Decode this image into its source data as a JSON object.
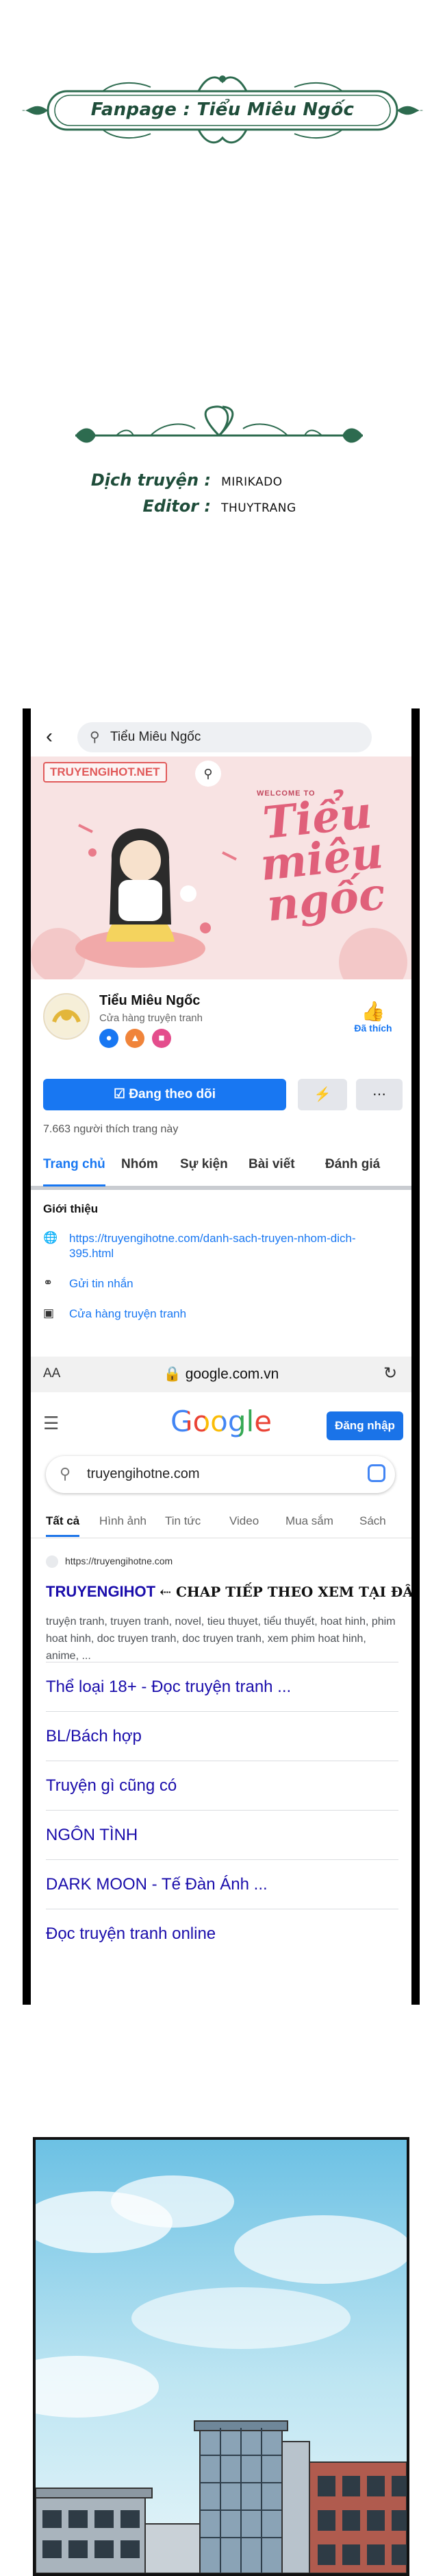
{
  "credits": {
    "fanpage_label": "Fanpage : Tiểu Miêu Ngốc",
    "translator_key": "Dịch truyện :",
    "translator_value": "MIRIKADO",
    "editor_key": "Editor :",
    "editor_value": "THUYTRANG"
  },
  "facebook": {
    "search_query": "Tiểu Miêu Ngốc",
    "cover": {
      "watermark": "TRUYENGIHOT.NET",
      "welcome": "WELCOME TO",
      "title": "Tiểu miêu ngốc"
    },
    "page_name": "Tiểu Miêu Ngốc",
    "page_category": "Cửa hàng truyện tranh",
    "like_label": "Đã thích",
    "follow_label": "Đang theo dõi",
    "likes_count": "7.663 người thích trang này",
    "tabs": [
      "Trang chủ",
      "Nhóm",
      "Sự kiện",
      "Bài viết",
      "Đánh giá"
    ],
    "intro_heading": "Giới thiệu",
    "intro_link": "https://truyengihotne.com/danh-sach-truyen-nhom-dich-395.html",
    "intro_message": "Gửi tin nhắn",
    "intro_category": "Cửa hàng truyện tranh"
  },
  "browser": {
    "text_size": "AA",
    "url": "google.com.vn"
  },
  "google": {
    "logo": "Google",
    "sign_in": "Đăng nhập",
    "query": "truyengihotne.com",
    "tabs": [
      "Tất cả",
      "Hình ảnh",
      "Tin tức",
      "Video",
      "Mua sắm",
      "Sách"
    ],
    "result": {
      "url": "https://truyengihotne.com",
      "title": "TRUYENGIHOT",
      "promo": "⇠ CHAP TIẾP THEO XEM TẠI ĐÂY NHA",
      "snippet": "truyện tranh, truyen tranh, novel, tieu thuyet, tiểu thuyết, hoat hinh, phim hoat hinh, doc truyen tranh, doc truyen tranh, xem phim hoat hinh, anime, ..."
    },
    "sitelinks": [
      "Thể loại 18+ - Đọc truyện tranh ...",
      "BL/Bách hợp",
      "Truyện gì cũng có",
      "NGÔN TÌNH",
      "DARK MOON - Tế Đàn Ánh ...",
      "Đọc truyện tranh online"
    ]
  },
  "colors": {
    "credit_green": "#1f4d3a",
    "facebook_blue": "#1877f2",
    "google_blue": "#1a73e8",
    "link_blue": "#1a0dab"
  }
}
